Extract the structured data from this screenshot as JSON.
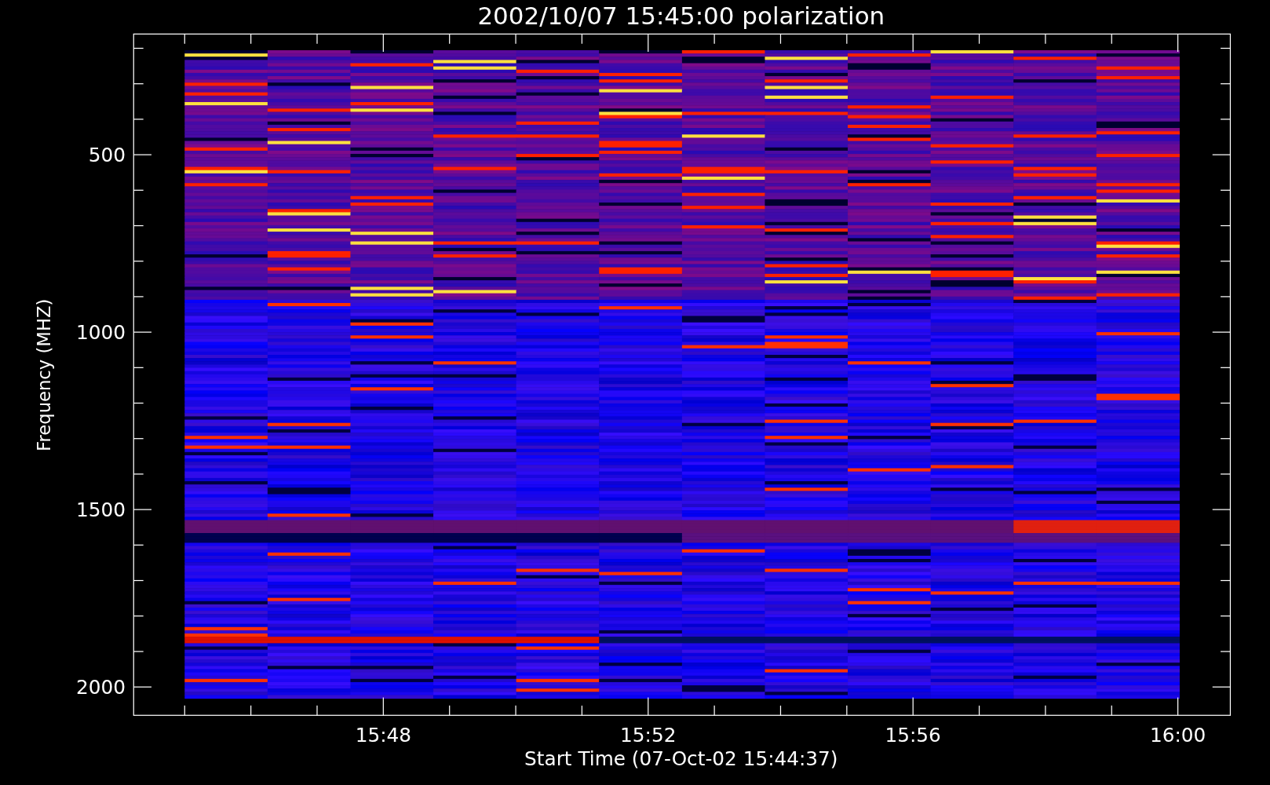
{
  "title": "2002/10/07 15:45:00 polarization",
  "y_axis": {
    "label": "Frequency (MHZ)",
    "ticks": [
      "500",
      "1000",
      "1500",
      "2000"
    ]
  },
  "x_axis": {
    "label": "Start Time (07-Oct-02 15:44:37)",
    "ticks": [
      "15:48",
      "15:52",
      "15:56",
      "16:00"
    ]
  }
}
